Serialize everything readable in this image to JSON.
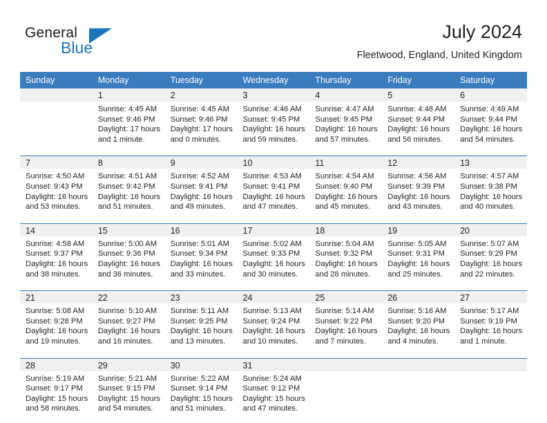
{
  "brand": {
    "name_part1": "General",
    "name_part2": "Blue",
    "flag_icon": "triangle-flag-icon",
    "accent_color": "#1b75bb"
  },
  "header": {
    "title": "July 2024",
    "location": "Fleetwood, England, United Kingdom"
  },
  "theme": {
    "header_blue": "#3a7cbe",
    "daynum_band": "#f0f0f0",
    "text": "#231f20"
  },
  "calendar": {
    "weekday_headers": [
      "Sunday",
      "Monday",
      "Tuesday",
      "Wednesday",
      "Thursday",
      "Friday",
      "Saturday"
    ],
    "weeks": [
      [
        {
          "day": "",
          "lines": []
        },
        {
          "day": "1",
          "lines": [
            "Sunrise: 4:45 AM",
            "Sunset: 9:46 PM",
            "Daylight: 17 hours",
            "and 1 minute."
          ]
        },
        {
          "day": "2",
          "lines": [
            "Sunrise: 4:45 AM",
            "Sunset: 9:46 PM",
            "Daylight: 17 hours",
            "and 0 minutes."
          ]
        },
        {
          "day": "3",
          "lines": [
            "Sunrise: 4:46 AM",
            "Sunset: 9:45 PM",
            "Daylight: 16 hours",
            "and 59 minutes."
          ]
        },
        {
          "day": "4",
          "lines": [
            "Sunrise: 4:47 AM",
            "Sunset: 9:45 PM",
            "Daylight: 16 hours",
            "and 57 minutes."
          ]
        },
        {
          "day": "5",
          "lines": [
            "Sunrise: 4:48 AM",
            "Sunset: 9:44 PM",
            "Daylight: 16 hours",
            "and 56 minutes."
          ]
        },
        {
          "day": "6",
          "lines": [
            "Sunrise: 4:49 AM",
            "Sunset: 9:44 PM",
            "Daylight: 16 hours",
            "and 54 minutes."
          ]
        }
      ],
      [
        {
          "day": "7",
          "lines": [
            "Sunrise: 4:50 AM",
            "Sunset: 9:43 PM",
            "Daylight: 16 hours",
            "and 53 minutes."
          ]
        },
        {
          "day": "8",
          "lines": [
            "Sunrise: 4:51 AM",
            "Sunset: 9:42 PM",
            "Daylight: 16 hours",
            "and 51 minutes."
          ]
        },
        {
          "day": "9",
          "lines": [
            "Sunrise: 4:52 AM",
            "Sunset: 9:41 PM",
            "Daylight: 16 hours",
            "and 49 minutes."
          ]
        },
        {
          "day": "10",
          "lines": [
            "Sunrise: 4:53 AM",
            "Sunset: 9:41 PM",
            "Daylight: 16 hours",
            "and 47 minutes."
          ]
        },
        {
          "day": "11",
          "lines": [
            "Sunrise: 4:54 AM",
            "Sunset: 9:40 PM",
            "Daylight: 16 hours",
            "and 45 minutes."
          ]
        },
        {
          "day": "12",
          "lines": [
            "Sunrise: 4:56 AM",
            "Sunset: 9:39 PM",
            "Daylight: 16 hours",
            "and 43 minutes."
          ]
        },
        {
          "day": "13",
          "lines": [
            "Sunrise: 4:57 AM",
            "Sunset: 9:38 PM",
            "Daylight: 16 hours",
            "and 40 minutes."
          ]
        }
      ],
      [
        {
          "day": "14",
          "lines": [
            "Sunrise: 4:58 AM",
            "Sunset: 9:37 PM",
            "Daylight: 16 hours",
            "and 38 minutes."
          ]
        },
        {
          "day": "15",
          "lines": [
            "Sunrise: 5:00 AM",
            "Sunset: 9:36 PM",
            "Daylight: 16 hours",
            "and 36 minutes."
          ]
        },
        {
          "day": "16",
          "lines": [
            "Sunrise: 5:01 AM",
            "Sunset: 9:34 PM",
            "Daylight: 16 hours",
            "and 33 minutes."
          ]
        },
        {
          "day": "17",
          "lines": [
            "Sunrise: 5:02 AM",
            "Sunset: 9:33 PM",
            "Daylight: 16 hours",
            "and 30 minutes."
          ]
        },
        {
          "day": "18",
          "lines": [
            "Sunrise: 5:04 AM",
            "Sunset: 9:32 PM",
            "Daylight: 16 hours",
            "and 28 minutes."
          ]
        },
        {
          "day": "19",
          "lines": [
            "Sunrise: 5:05 AM",
            "Sunset: 9:31 PM",
            "Daylight: 16 hours",
            "and 25 minutes."
          ]
        },
        {
          "day": "20",
          "lines": [
            "Sunrise: 5:07 AM",
            "Sunset: 9:29 PM",
            "Daylight: 16 hours",
            "and 22 minutes."
          ]
        }
      ],
      [
        {
          "day": "21",
          "lines": [
            "Sunrise: 5:08 AM",
            "Sunset: 9:28 PM",
            "Daylight: 16 hours",
            "and 19 minutes."
          ]
        },
        {
          "day": "22",
          "lines": [
            "Sunrise: 5:10 AM",
            "Sunset: 9:27 PM",
            "Daylight: 16 hours",
            "and 16 minutes."
          ]
        },
        {
          "day": "23",
          "lines": [
            "Sunrise: 5:11 AM",
            "Sunset: 9:25 PM",
            "Daylight: 16 hours",
            "and 13 minutes."
          ]
        },
        {
          "day": "24",
          "lines": [
            "Sunrise: 5:13 AM",
            "Sunset: 9:24 PM",
            "Daylight: 16 hours",
            "and 10 minutes."
          ]
        },
        {
          "day": "25",
          "lines": [
            "Sunrise: 5:14 AM",
            "Sunset: 9:22 PM",
            "Daylight: 16 hours",
            "and 7 minutes."
          ]
        },
        {
          "day": "26",
          "lines": [
            "Sunrise: 5:16 AM",
            "Sunset: 9:20 PM",
            "Daylight: 16 hours",
            "and 4 minutes."
          ]
        },
        {
          "day": "27",
          "lines": [
            "Sunrise: 5:17 AM",
            "Sunset: 9:19 PM",
            "Daylight: 16 hours",
            "and 1 minute."
          ]
        }
      ],
      [
        {
          "day": "28",
          "lines": [
            "Sunrise: 5:19 AM",
            "Sunset: 9:17 PM",
            "Daylight: 15 hours",
            "and 58 minutes."
          ]
        },
        {
          "day": "29",
          "lines": [
            "Sunrise: 5:21 AM",
            "Sunset: 9:15 PM",
            "Daylight: 15 hours",
            "and 54 minutes."
          ]
        },
        {
          "day": "30",
          "lines": [
            "Sunrise: 5:22 AM",
            "Sunset: 9:14 PM",
            "Daylight: 15 hours",
            "and 51 minutes."
          ]
        },
        {
          "day": "31",
          "lines": [
            "Sunrise: 5:24 AM",
            "Sunset: 9:12 PM",
            "Daylight: 15 hours",
            "and 47 minutes."
          ]
        },
        {
          "day": "",
          "lines": []
        },
        {
          "day": "",
          "lines": []
        },
        {
          "day": "",
          "lines": []
        }
      ]
    ]
  }
}
